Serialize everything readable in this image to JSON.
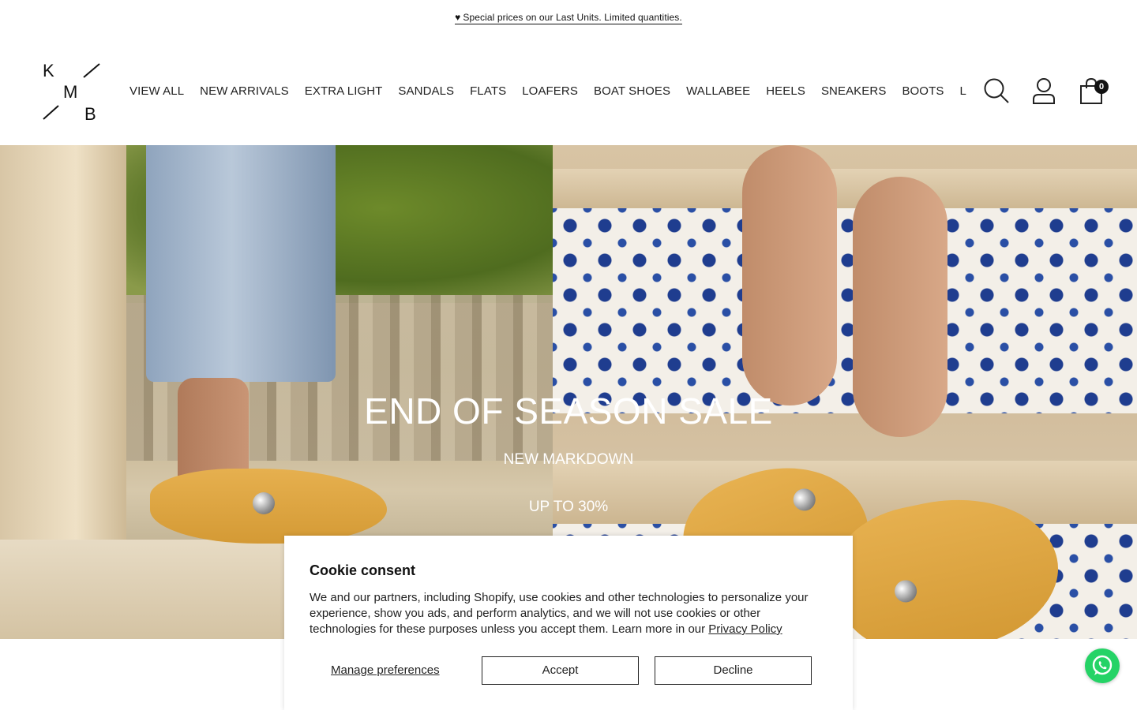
{
  "announcement": {
    "heart_icon": "♥",
    "text": "Special prices on our Last Units. Limited quantities."
  },
  "brand": {
    "logo_letters": [
      "K",
      "M",
      "B"
    ]
  },
  "nav": {
    "items": [
      "VIEW ALL",
      "NEW ARRIVALS",
      "EXTRA LIGHT",
      "SANDALS",
      "FLATS",
      "LOAFERS",
      "BOAT SHOES",
      "WALLABEE",
      "HEELS",
      "SNEAKERS",
      "BOOTS",
      "LAST UNITS"
    ]
  },
  "header_icons": {
    "search": "search-icon",
    "account": "account-icon",
    "cart": "cart-icon",
    "cart_count": "0"
  },
  "hero": {
    "title": "END OF SEASON SALE",
    "subtitle": "NEW MARKDOWN",
    "subtitle2": "UP TO 30%"
  },
  "cookie": {
    "title": "Cookie consent",
    "body": "We and our partners, including Shopify, use cookies and other technologies to personalize your experience, show you ads, and perform analytics, and we will not use cookies or other technologies for these purposes unless you accept them. Learn more in our ",
    "privacy_link": "Privacy Policy",
    "manage_label": "Manage preferences",
    "accept_label": "Accept",
    "decline_label": "Decline"
  },
  "whatsapp": {
    "icon": "whatsapp-icon",
    "color": "#25d366"
  }
}
